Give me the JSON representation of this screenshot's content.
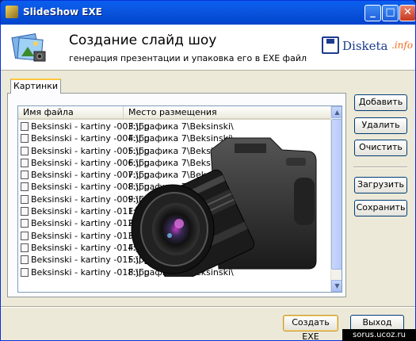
{
  "window": {
    "title": "SlideShow EXE"
  },
  "header": {
    "title": "Создание слайд шоу",
    "subtitle": "генерация презентации и упаковка его в EXE файл",
    "brand_name": "Disketa",
    "brand_tld": ".info"
  },
  "tab": {
    "label": "Картинки"
  },
  "list": {
    "columns": [
      "Имя файла",
      "Место размещения"
    ],
    "rows": [
      {
        "name": "Beksinski - kartiny -003.jpg",
        "path": "F:\\Графика 7\\Beksinski\\"
      },
      {
        "name": "Beksinski - kartiny -004.jpg",
        "path": "F:\\Графика 7\\Beksinski\\"
      },
      {
        "name": "Beksinski - kartiny -005.jpg",
        "path": "F:\\Графика 7\\Beksinski\\"
      },
      {
        "name": "Beksinski - kartiny -006.jpg",
        "path": "F:\\Графика 7\\Beksinski\\"
      },
      {
        "name": "Beksinski - kartiny -007.jpg",
        "path": "F:\\Графика 7\\Beksinski\\"
      },
      {
        "name": "Beksinski - kartiny -008.jpg",
        "path": "F:\\Графика 7\\Beksinski\\"
      },
      {
        "name": "Beksinski - kartiny -009.jpg",
        "path": "F:\\Графика 7\\Beksinski\\"
      },
      {
        "name": "Beksinski - kartiny -011.jpg",
        "path": "F:\\Графика 7\\Beksinski\\"
      },
      {
        "name": "Beksinski - kartiny -012.jpg",
        "path": "F:\\Графика 7\\Beksinski\\"
      },
      {
        "name": "Beksinski - kartiny -013.jpg",
        "path": "F:\\Графика 7\\Beksinski\\"
      },
      {
        "name": "Beksinski - kartiny -014.jpg",
        "path": "F:\\Графика 7\\Beksinski\\"
      },
      {
        "name": "Beksinski - kartiny -015.jpg",
        "path": "F:\\Графика 7\\Beksinski\\"
      },
      {
        "name": "Beksinski - kartiny -018.jpg",
        "path": "F:\\Графика 7\\Beksinski\\"
      }
    ]
  },
  "side_buttons": {
    "add": "Добавить",
    "remove": "Удалить",
    "clear": "Очистить",
    "load": "Загрузить",
    "save": "Сохранить"
  },
  "footer": {
    "create": "Создать EXE",
    "exit": "Выход"
  },
  "watermark": "sorus.ucoz.ru",
  "colors": {
    "titlebar": "#0054e3",
    "brand": "#1b3b8f",
    "brand_accent": "#f26a1b"
  }
}
